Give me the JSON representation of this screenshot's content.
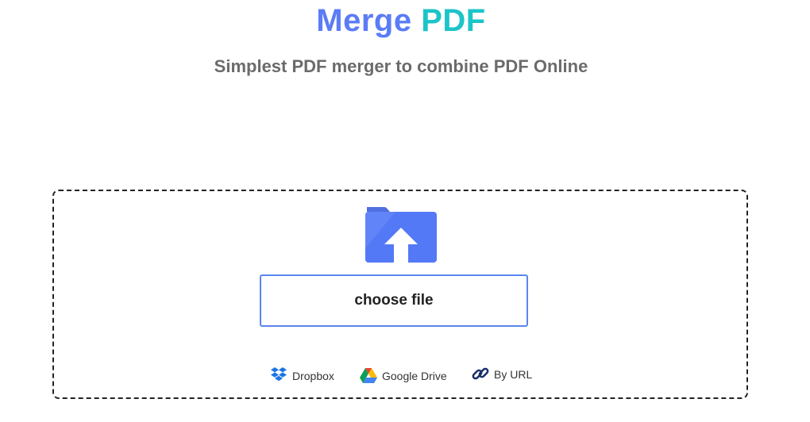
{
  "header": {
    "title_part1": "Merge",
    "title_part2": "PDF",
    "subtitle": "Simplest PDF merger to combine PDF Online"
  },
  "upload": {
    "choose_file_label": "choose file",
    "folder_icon": "folder-upload-icon"
  },
  "sources": [
    {
      "label": "Dropbox",
      "icon": "dropbox-icon"
    },
    {
      "label": "Google Drive",
      "icon": "google-drive-icon"
    },
    {
      "label": "By URL",
      "icon": "link-icon"
    }
  ],
  "colors": {
    "title_blue": "#5b7cf6",
    "title_teal": "#1cc4c8",
    "subtitle_gray": "#6b6b6b",
    "button_border": "#5b86f0",
    "folder_blue": "#5479f7"
  }
}
